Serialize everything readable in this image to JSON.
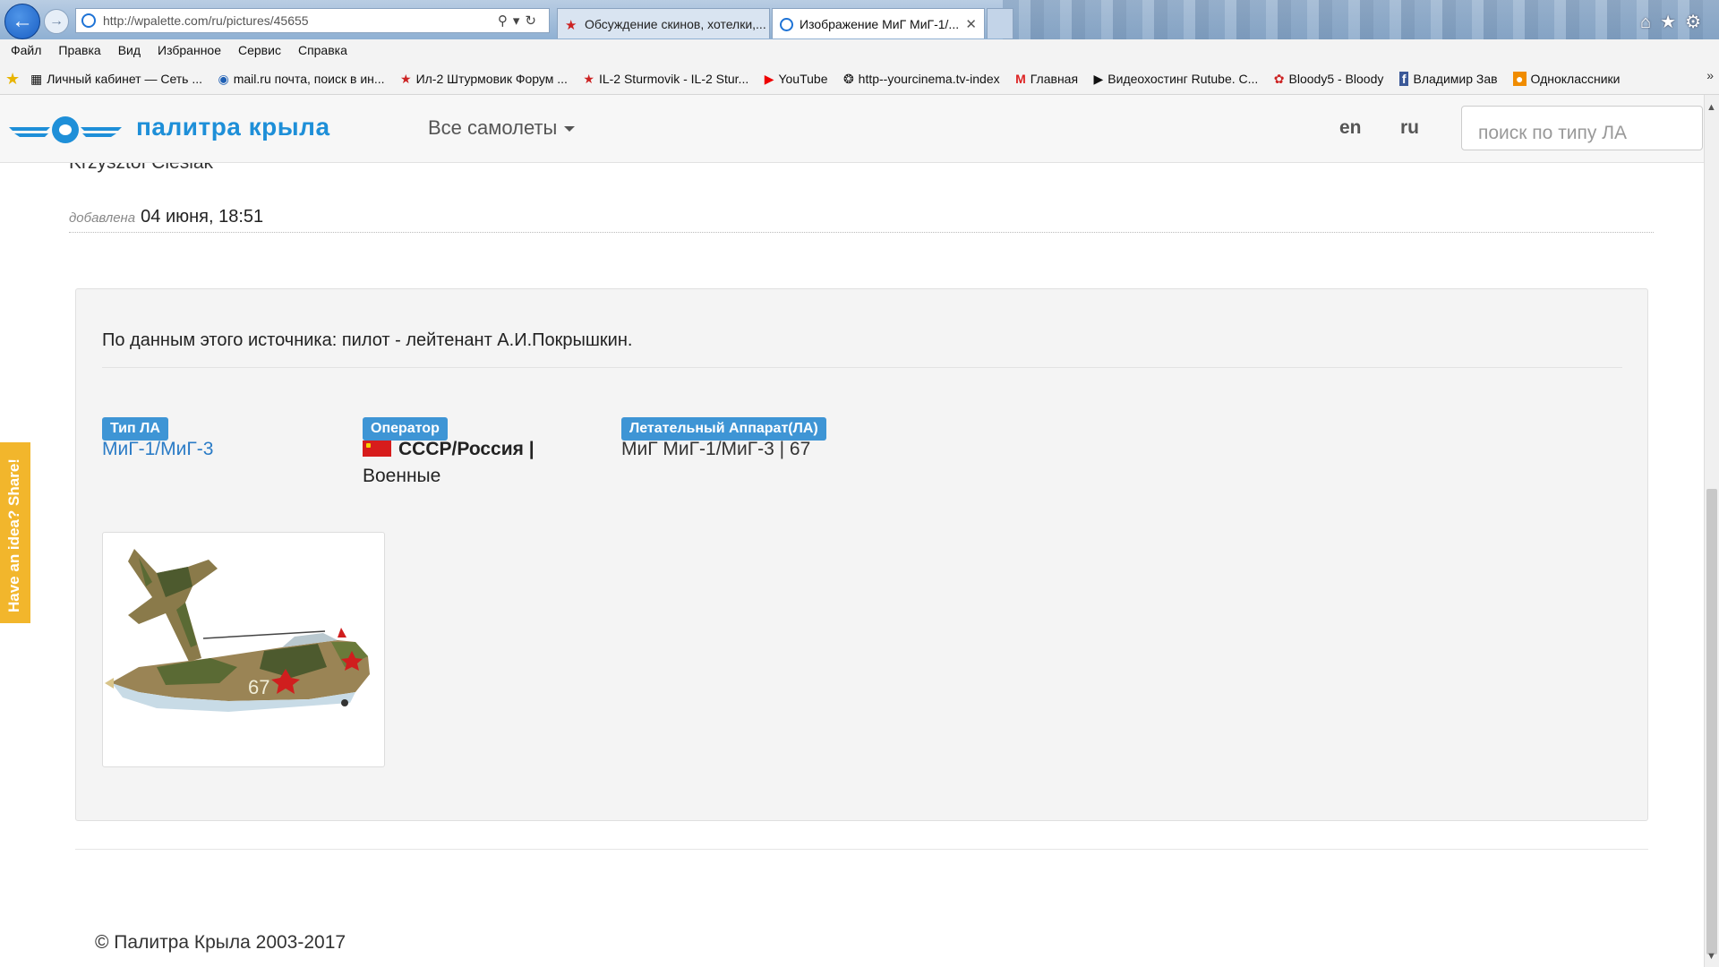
{
  "browser": {
    "url": "http://wpalette.com/ru/pictures/45655",
    "tabs": [
      {
        "label": "Обсуждение скинов, хотелки,..."
      },
      {
        "label": "Изображение МиГ МиГ-1/..."
      }
    ],
    "menu": [
      "Файл",
      "Правка",
      "Вид",
      "Избранное",
      "Сервис",
      "Справка"
    ],
    "favorites": [
      {
        "label": "Личный кабинет — Сеть ..."
      },
      {
        "label": "mail.ru почта, поиск в ин..."
      },
      {
        "label": "Ил-2 Штурмовик Форум ..."
      },
      {
        "label": "IL-2 Sturmovik - IL-2 Stur..."
      },
      {
        "label": "YouTube"
      },
      {
        "label": "http--yourcinema.tv-index"
      },
      {
        "label": "Главная"
      },
      {
        "label": "Видеохостинг Rutube. С..."
      },
      {
        "label": "Bloody5 - Bloody"
      },
      {
        "label": "Владимир Зав"
      },
      {
        "label": "Одноклассники"
      }
    ]
  },
  "site": {
    "logo_text": "палитра крыла",
    "nav_all": "Все самолеты",
    "lang_en": "en",
    "lang_ru": "ru",
    "search_placeholder": "поиск по типу ЛА"
  },
  "content": {
    "author": "Krzysztof Cieslak",
    "added_label": "добавлена",
    "added_date": "04 июня, 18:51",
    "description": "По данным этого источника: пилот - лейтенант А.И.Покрышкин.",
    "type_badge": "Тип ЛА",
    "type_value": "МиГ-1/МиГ-3",
    "operator_badge": "Оператор",
    "operator_value": "СССР/Россия |",
    "operator_value2": "Военные",
    "aircraft_badge": "Летательный Аппарат(ЛА)",
    "aircraft_value": "МиГ МиГ-1/МиГ-3 | 67",
    "aircraft_number": "67"
  },
  "footer": {
    "copyright": "© Палитра Крыла 2003-2017"
  },
  "feedback_tab": "Have an idea? Share!",
  "colors": {
    "brand_blue": "#1e8fd8",
    "badge_blue": "#3e95d5",
    "feedback_yellow": "#f2b62c"
  }
}
